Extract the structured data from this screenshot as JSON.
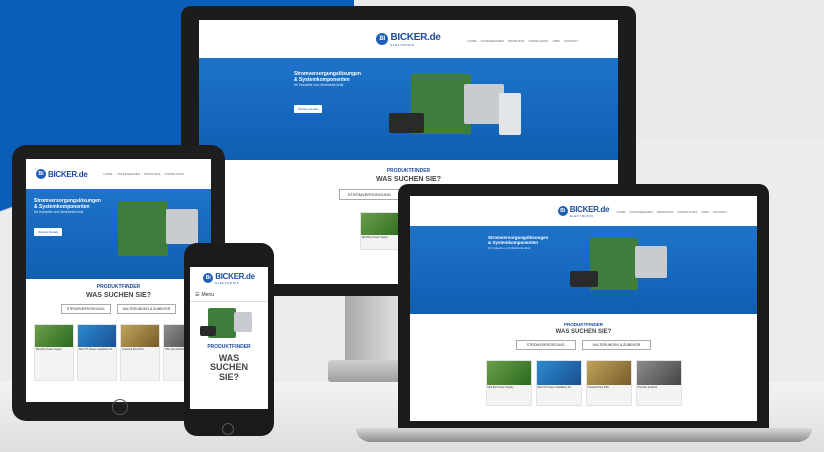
{
  "site": {
    "logo_text": "BICKER.de",
    "logo_sub": "ELEKTRONIK",
    "logo_icon": "Bi"
  },
  "nav": [
    "HOME",
    "UNTERNEHMEN",
    "PRODUKTE",
    "DOWNLOADS",
    "JOBS",
    "KONTAKT"
  ],
  "hero": {
    "title": "Stromversorgungslösungen & Systemkomponenten",
    "subtitle": "für Industrie und Medizintechnik",
    "button": "Weitere Details"
  },
  "finder": {
    "badge": "PRODUKTFINDER",
    "question": "WAS SUCHEN SIE?",
    "btn_power": "STROMVERSORGUNG",
    "btn_mounting": "HALTERUNGEN & ZUBEHÖR"
  },
  "phone": {
    "menu_label": "Menu",
    "question": "WAS SUCHEN SIE?"
  },
  "cards": [
    {
      "title": "Mini-Box Power Supply",
      "text": "Power Board Kit"
    },
    {
      "title": "Mini-ITX Power Installation Kit",
      "text": "ITX Power"
    },
    {
      "title": "Industrial Pico PSU",
      "text": "DC-DC Modul"
    },
    {
      "title": "PSU-Set Zubehör",
      "text": "Zubehör Kit"
    }
  ],
  "colors": {
    "brand_blue": "#1d5fb8",
    "background_blue": "#0a5db8"
  }
}
